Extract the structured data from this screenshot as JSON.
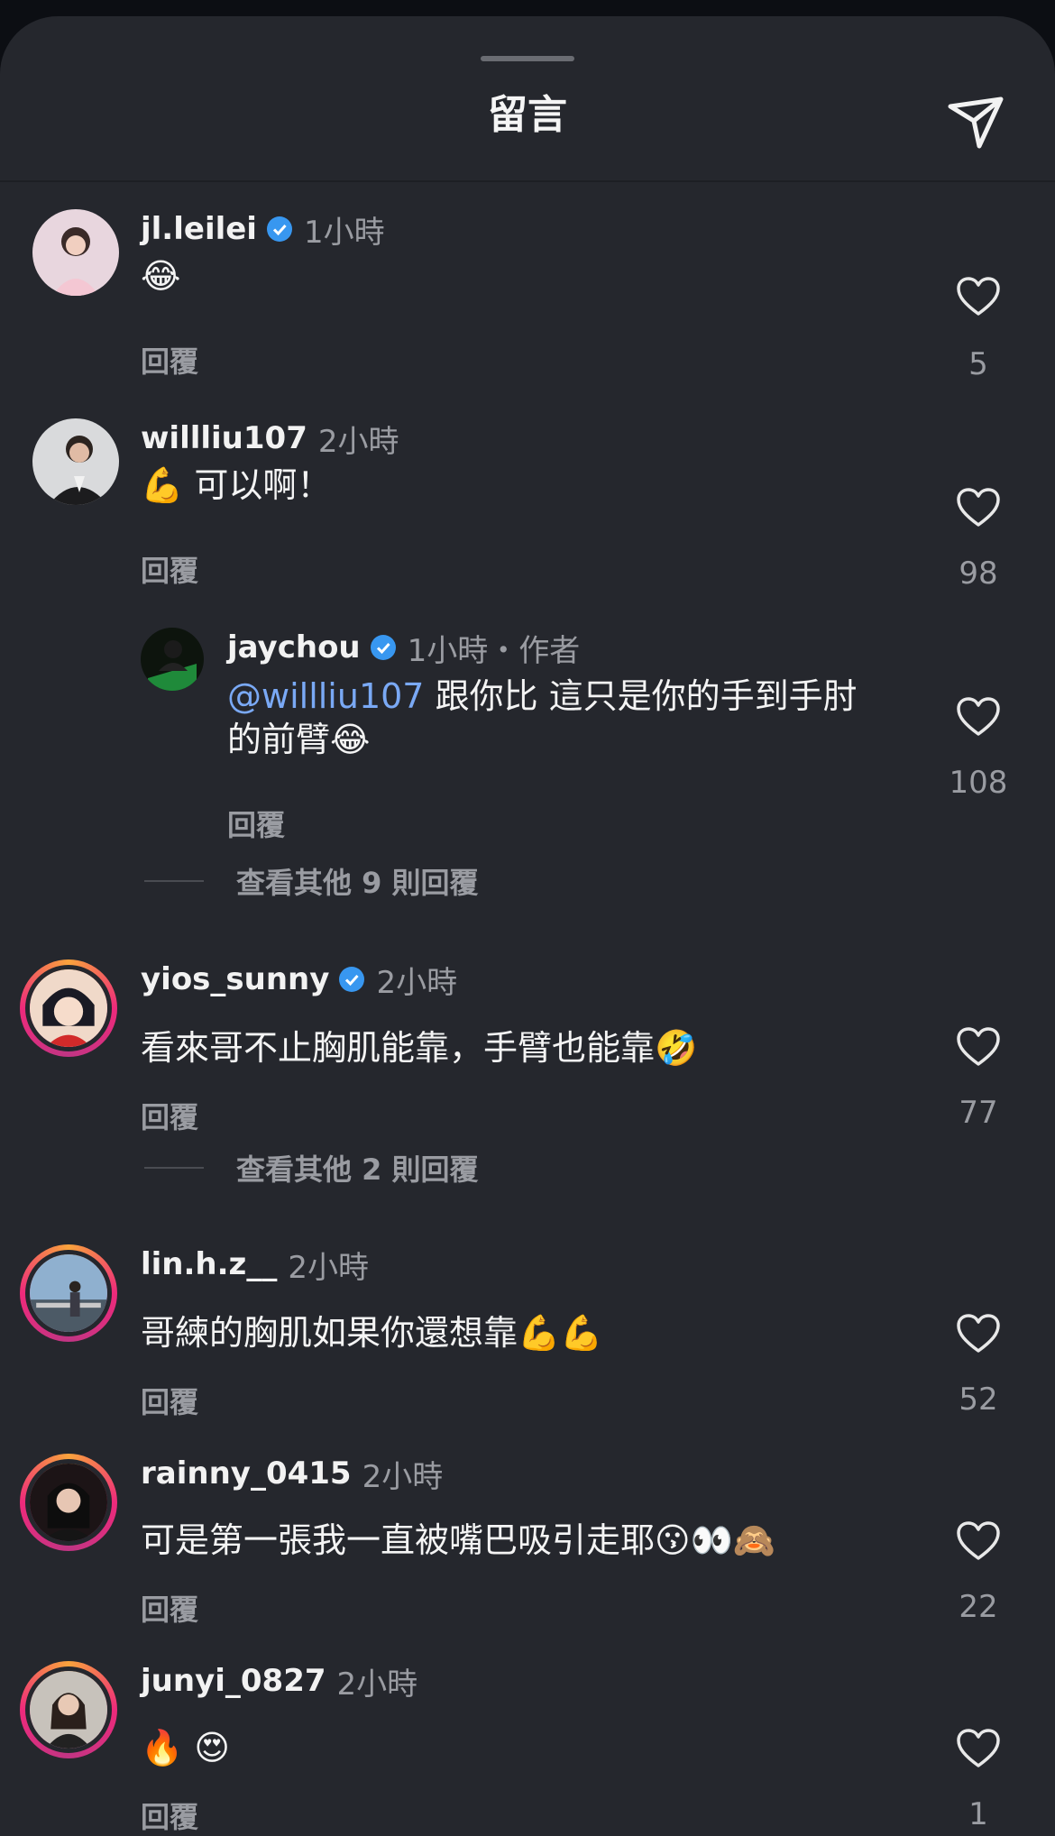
{
  "header": {
    "title": "留言"
  },
  "reply_label": "回覆",
  "comments": [
    {
      "username": "jl.leilei",
      "verified": true,
      "time": "1小時",
      "text": "😂",
      "likes": "5"
    },
    {
      "username": "willliu107",
      "verified": false,
      "time": "2小時",
      "text": "💪 可以啊！",
      "likes": "98"
    },
    {
      "username": "jaychou",
      "verified": true,
      "time": "1小時・作者",
      "mention": "@willliu107",
      "text_line1": " 跟你比 這只是你的手到手肘",
      "text_line2": "的前臂😂",
      "likes": "108"
    },
    {
      "username": "yios_sunny",
      "verified": true,
      "time": "2小時",
      "text": "看來哥不止胸肌能靠，手臂也能靠🤣",
      "likes": "77"
    },
    {
      "username": "lin.h.z__",
      "verified": false,
      "time": "2小時",
      "text": "哥練的胸肌如果你還想靠💪💪",
      "likes": "52"
    },
    {
      "username": "rainny_0415",
      "verified": false,
      "time": "2小時",
      "text": "可是第一張我一直被嘴巴吸引走耶😗👀🙈",
      "likes": "22"
    },
    {
      "username": "junyi_0827",
      "verified": false,
      "time": "2小時",
      "text": "🔥 😍",
      "likes": "1"
    }
  ],
  "view_more": [
    "查看其他 9 則回覆",
    "查看其他 2 則回覆"
  ],
  "icons": {
    "send": "send-icon",
    "heart": "heart-outline-icon",
    "verified": "verified-badge-icon"
  },
  "colors": {
    "background": "#25272d",
    "mention": "#7aa9f5",
    "verified": "#3897f0"
  }
}
